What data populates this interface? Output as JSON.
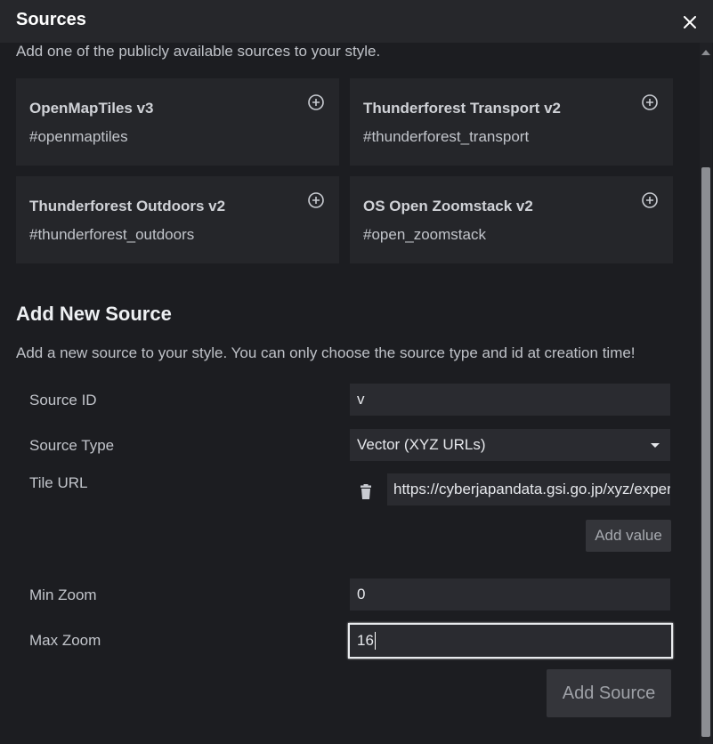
{
  "dialog": {
    "title": "Sources"
  },
  "icons": {
    "close": "close-icon",
    "add": "plus-circle-icon",
    "delete": "trash-icon",
    "dropdown": "caret-down-icon"
  },
  "public_sources": {
    "intro": "Add one of the publicly available sources to your style.",
    "cards": [
      {
        "title": "OpenMapTiles v3",
        "id": "#openmaptiles"
      },
      {
        "title": "Thunderforest Transport v2",
        "id": "#thunderforest_transport"
      },
      {
        "title": "Thunderforest Outdoors v2",
        "id": "#thunderforest_outdoors"
      },
      {
        "title": "OS Open Zoomstack v2",
        "id": "#open_zoomstack"
      }
    ]
  },
  "new_source": {
    "title": "Add New Source",
    "description": "Add a new source to your style. You can only choose the source type and id at creation time!",
    "source_id_label": "Source ID",
    "source_id_value": "v",
    "source_type_label": "Source Type",
    "source_type_value": "Vector (XYZ URLs)",
    "tile_url_label": "Tile URL",
    "tile_url_value": "https://cyberjapandata.gsi.go.jp/xyz/experimental_bvmap/{z}/{x}/{y}.pbf",
    "add_value_label": "Add value",
    "min_zoom_label": "Min Zoom",
    "min_zoom_value": "0",
    "max_zoom_label": "Max Zoom",
    "max_zoom_value": "16",
    "add_source_label": "Add Source"
  }
}
